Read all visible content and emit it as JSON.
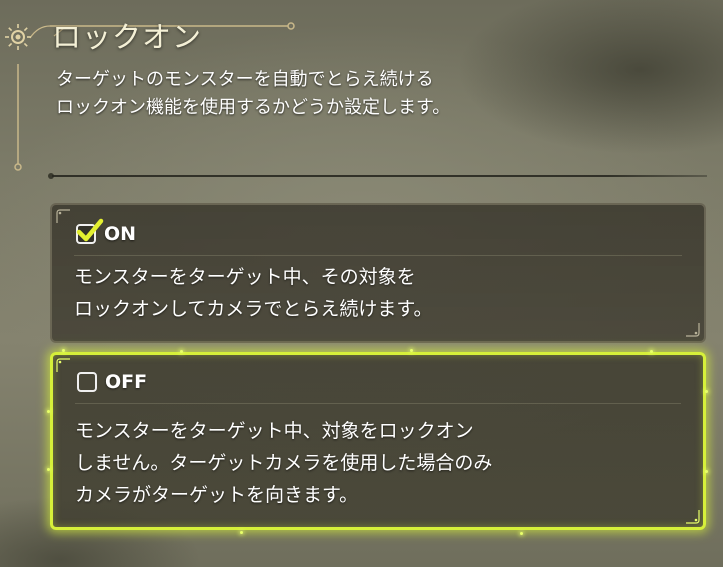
{
  "header": {
    "title": "ロックオン",
    "description_lines": [
      "ターゲットのモンスターを自動でとらえ続ける",
      "ロックオン機能を使用するかどうか設定します。"
    ]
  },
  "options": [
    {
      "label": "ON",
      "checked": true,
      "selected": false,
      "lines": [
        "モンスターをターゲット中、その対象を",
        "ロックオンしてカメラでとらえ続けます。"
      ]
    },
    {
      "label": "OFF",
      "checked": false,
      "selected": true,
      "lines": [
        "モンスターをターゲット中、対象をロックオン",
        "しません。ターゲットカメラを使用した場合のみ",
        "カメラがターゲットを向きます。"
      ]
    }
  ],
  "colors": {
    "highlight": "#d6f03a",
    "check": "#e4f030",
    "text": "#ffffff",
    "ornament": "#c9b88a"
  },
  "icons": {
    "header": "sun-ornament-icon",
    "checked": "checkmark-icon",
    "unchecked": "empty-checkbox-icon"
  }
}
